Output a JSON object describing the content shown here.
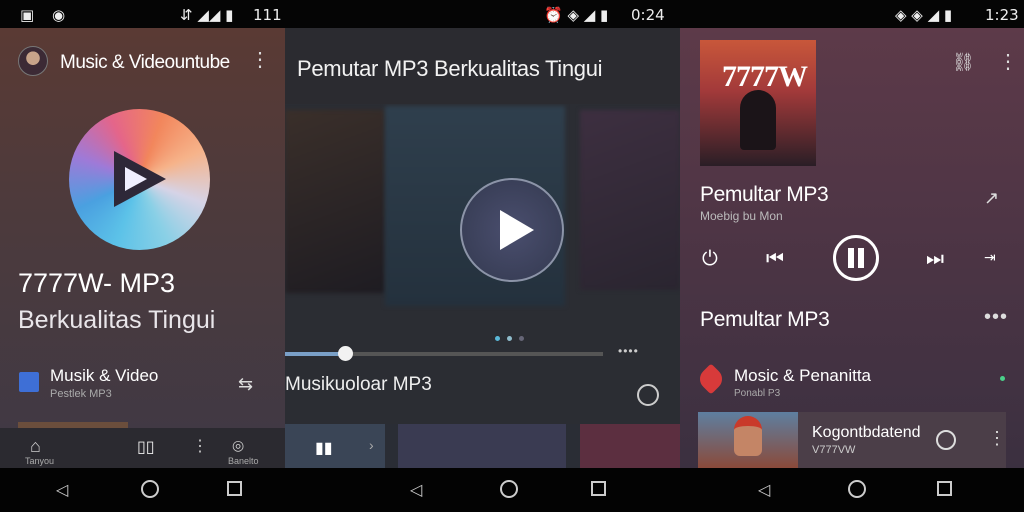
{
  "status": {
    "left_clock": "111",
    "mid_clock": "0:24",
    "right_clock": "1:23"
  },
  "panel1": {
    "title": "Music & Videountube",
    "headline": "7777W- MP3",
    "subheadline": "Berkualitas Tingui",
    "item_title": "Musik & Video",
    "item_sub": "Pestlek MP3",
    "nav_home_label": "Tanyou",
    "nav_mask_label": "Banelto"
  },
  "panel2": {
    "title": "Pemutar MP3 Berkualitas Tingui",
    "song_title": "Musikuoloar MP3",
    "song_sub": "",
    "progress": 0.19
  },
  "panel3": {
    "cover_title": "7777W",
    "track_title": "Pemultar MP3",
    "track_sub": "Moebig bu Mon",
    "section_title": "Pemultar MP3",
    "list_title": "Mosic & Penanitta",
    "list_sub": "Ponabl P3",
    "row_title": "Kogontbdatend",
    "row_sub": "V777VW"
  },
  "icons": {
    "close_icon": "close-icon",
    "shield_icon": "shield-icon"
  }
}
